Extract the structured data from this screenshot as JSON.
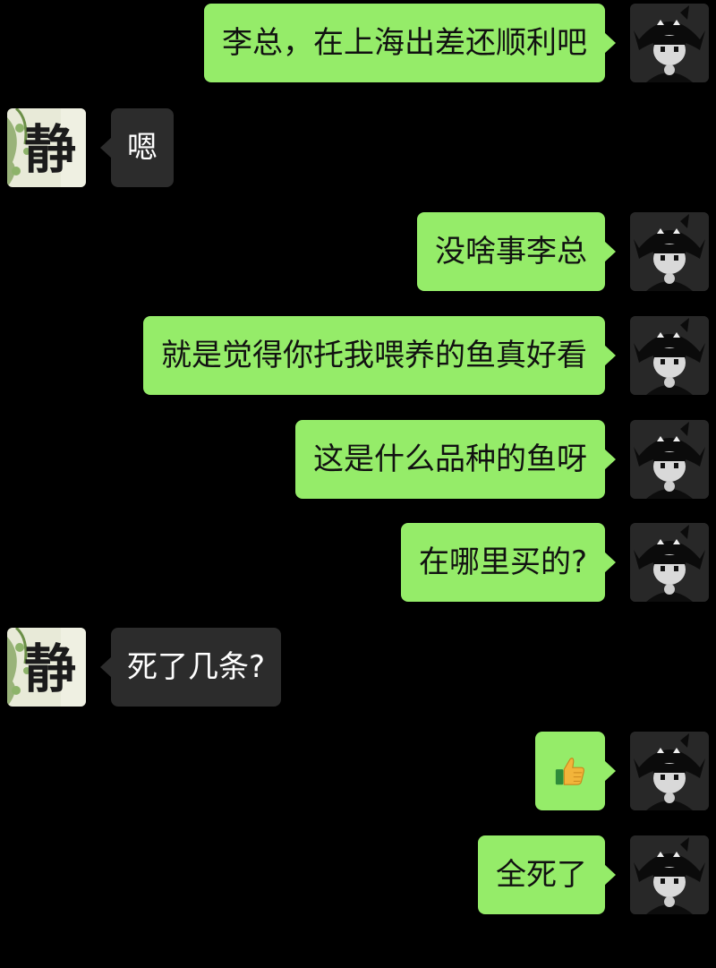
{
  "messages": [
    {
      "side": "me",
      "text": "李总，在上海出差还顺利吧"
    },
    {
      "side": "them",
      "text": "嗯"
    },
    {
      "side": "me",
      "text": "没啥事李总"
    },
    {
      "side": "me",
      "text": "就是觉得你托我喂养的鱼真好看"
    },
    {
      "side": "me",
      "text": "这是什么品种的鱼呀"
    },
    {
      "side": "me",
      "text": "在哪里买的?"
    },
    {
      "side": "them",
      "text": "死了几条?"
    },
    {
      "side": "me",
      "emoji": "thumbs-up-icon"
    },
    {
      "side": "me",
      "text": "全死了"
    }
  ],
  "contact_avatar": {
    "glyph": "静"
  },
  "colors": {
    "background": "#000000",
    "my_bubble": "#95ec69",
    "their_bubble": "#2c2c2c",
    "my_text": "#111111",
    "their_text": "#ffffff"
  }
}
